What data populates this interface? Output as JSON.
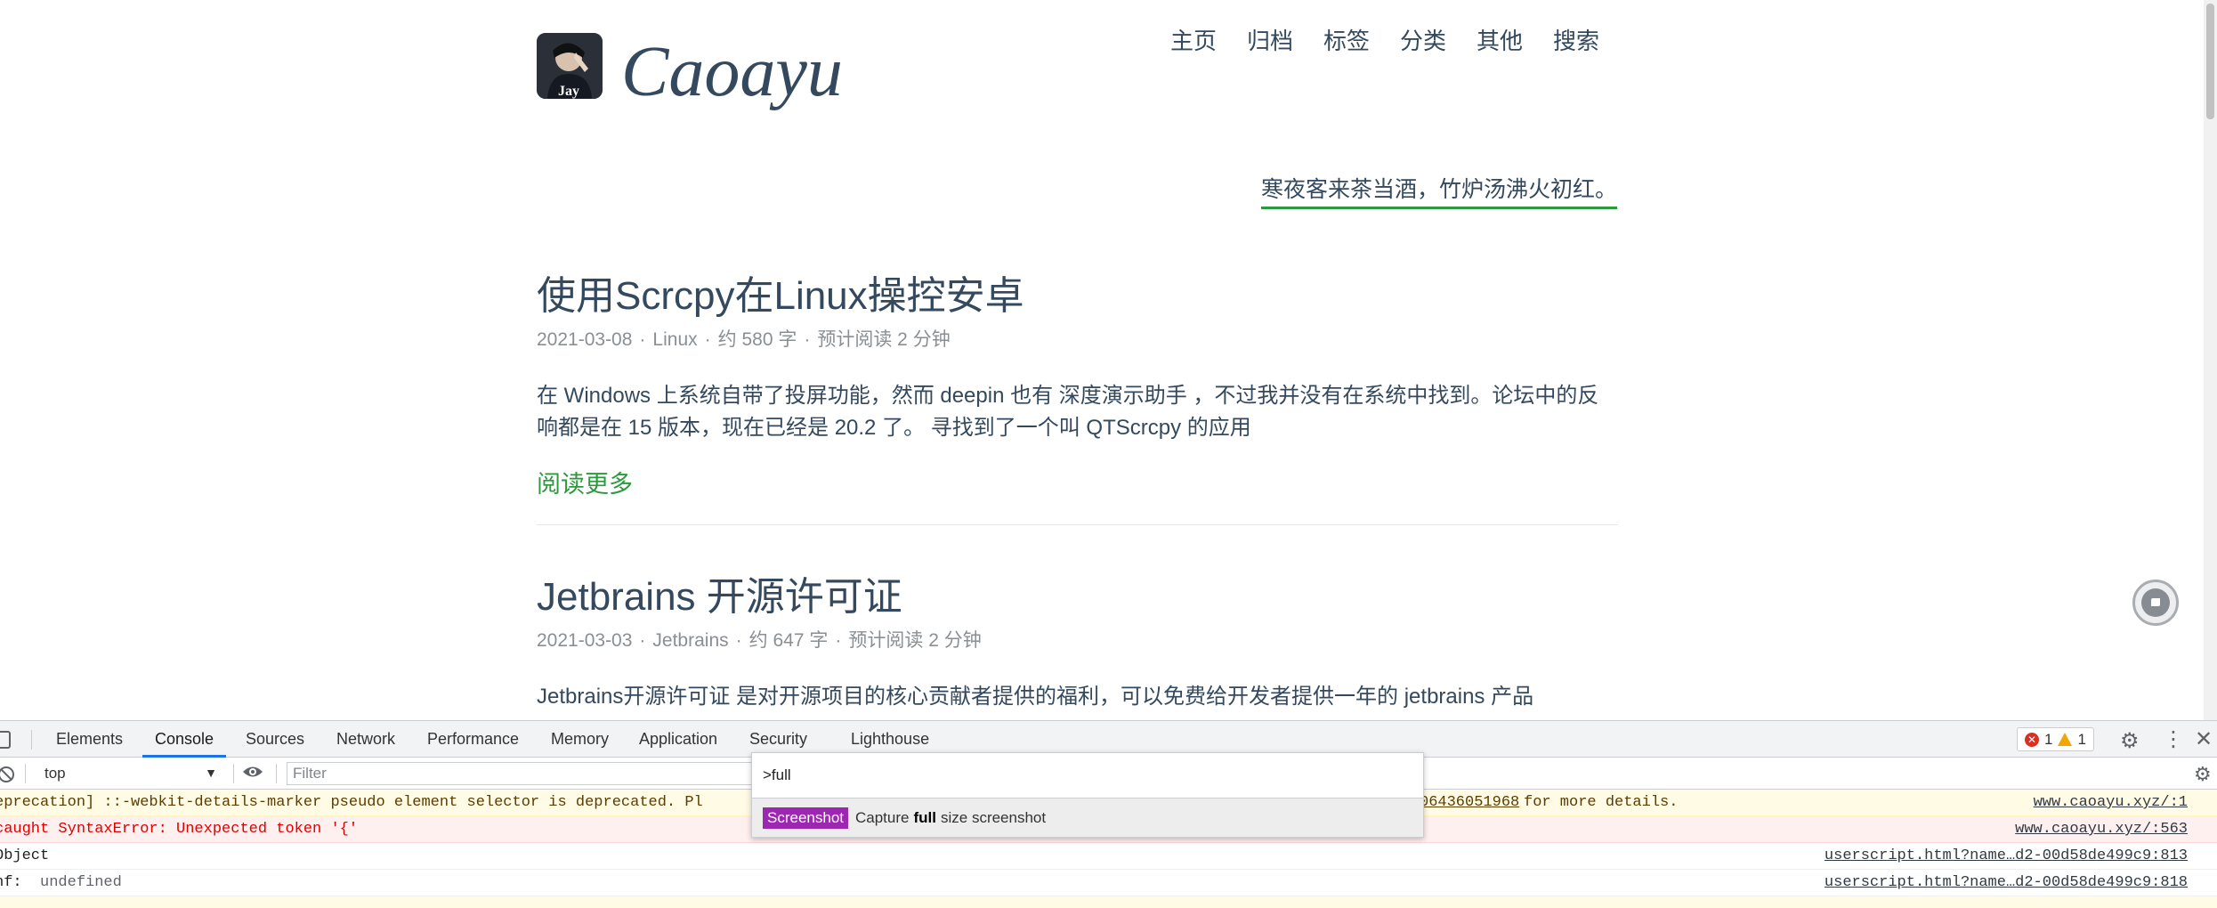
{
  "blog": {
    "logo_text": "Caoayu",
    "avatar_label": "Jay",
    "nav": [
      "主页",
      "归档",
      "标签",
      "分类",
      "其他",
      "搜索"
    ],
    "motto": "寒夜客来茶当酒，竹炉汤沸火初红。",
    "posts": [
      {
        "title": "使用Scrcpy在Linux操控安卓",
        "date": "2021-03-08",
        "category": "Linux",
        "words": "约 580 字",
        "read_time": "预计阅读 2 分钟",
        "excerpt": "在 Windows 上系统自带了投屏功能，然而 deepin 也有 深度演示助手 ，不过我并没有在系统中找到。论坛中的反响都是在 15 版本，现在已经是 20.2 了。 寻找到了一个叫 QTScrcpy 的应用",
        "read_more": "阅读更多"
      },
      {
        "title": "Jetbrains 开源许可证",
        "date": "2021-03-03",
        "category": "Jetbrains",
        "words": "约 647 字",
        "read_time": "预计阅读 2 分钟",
        "excerpt": "Jetbrains开源许可证 是对开源项目的核心贡献者提供的福利，可以免费给开发者提供一年的 jetbrains 产品"
      }
    ],
    "meta_sep": "·"
  },
  "devtools": {
    "tabs": [
      "Elements",
      "Console",
      "Sources",
      "Network",
      "Performance",
      "Memory",
      "Application",
      "Security",
      "Lighthouse"
    ],
    "active_tab": "Console",
    "issues_errors": "1",
    "issues_warnings": "1",
    "context": "top",
    "filter_placeholder": "Filter",
    "console": {
      "rows": [
        {
          "message": "eprecation] ::-webkit-details-marker pseudo element selector is deprecated. Pl",
          "link_tail": "06436051968",
          "message_tail": " for more details.",
          "source": "www.caoayu.xyz/:1"
        },
        {
          "message": "caught SyntaxError: Unexpected token '{'",
          "source": "www.caoayu.xyz/:563"
        },
        {
          "message": "Object",
          "source": "userscript.html?name…d2-00d58de499c9:813"
        },
        {
          "key": "nf:",
          "value": "undefined",
          "source": "userscript.html?name…d2-00d58de499c9:818"
        }
      ]
    },
    "command_menu": {
      "input_value": ">full",
      "item_badge": "Screenshot",
      "item_prefix": "Capture",
      "item_match": "full",
      "item_suffix": "size screenshot"
    }
  },
  "icons": {
    "inspect": "inspect-element-icon",
    "clear": "clear-console-icon",
    "eye": "live-expression-eye-icon",
    "gear": "settings-gear-icon",
    "more": "more-vertical-icon",
    "close": "close-icon",
    "scroll_top": "back-to-top-icon"
  },
  "colors": {
    "text": "#34495e",
    "accent_green": "#2b9a3c",
    "meta": "#8a8f94",
    "devtools_blue": "#1a73e8",
    "screenshot_badge": "#9c27b0",
    "error_red": "#e00000"
  }
}
